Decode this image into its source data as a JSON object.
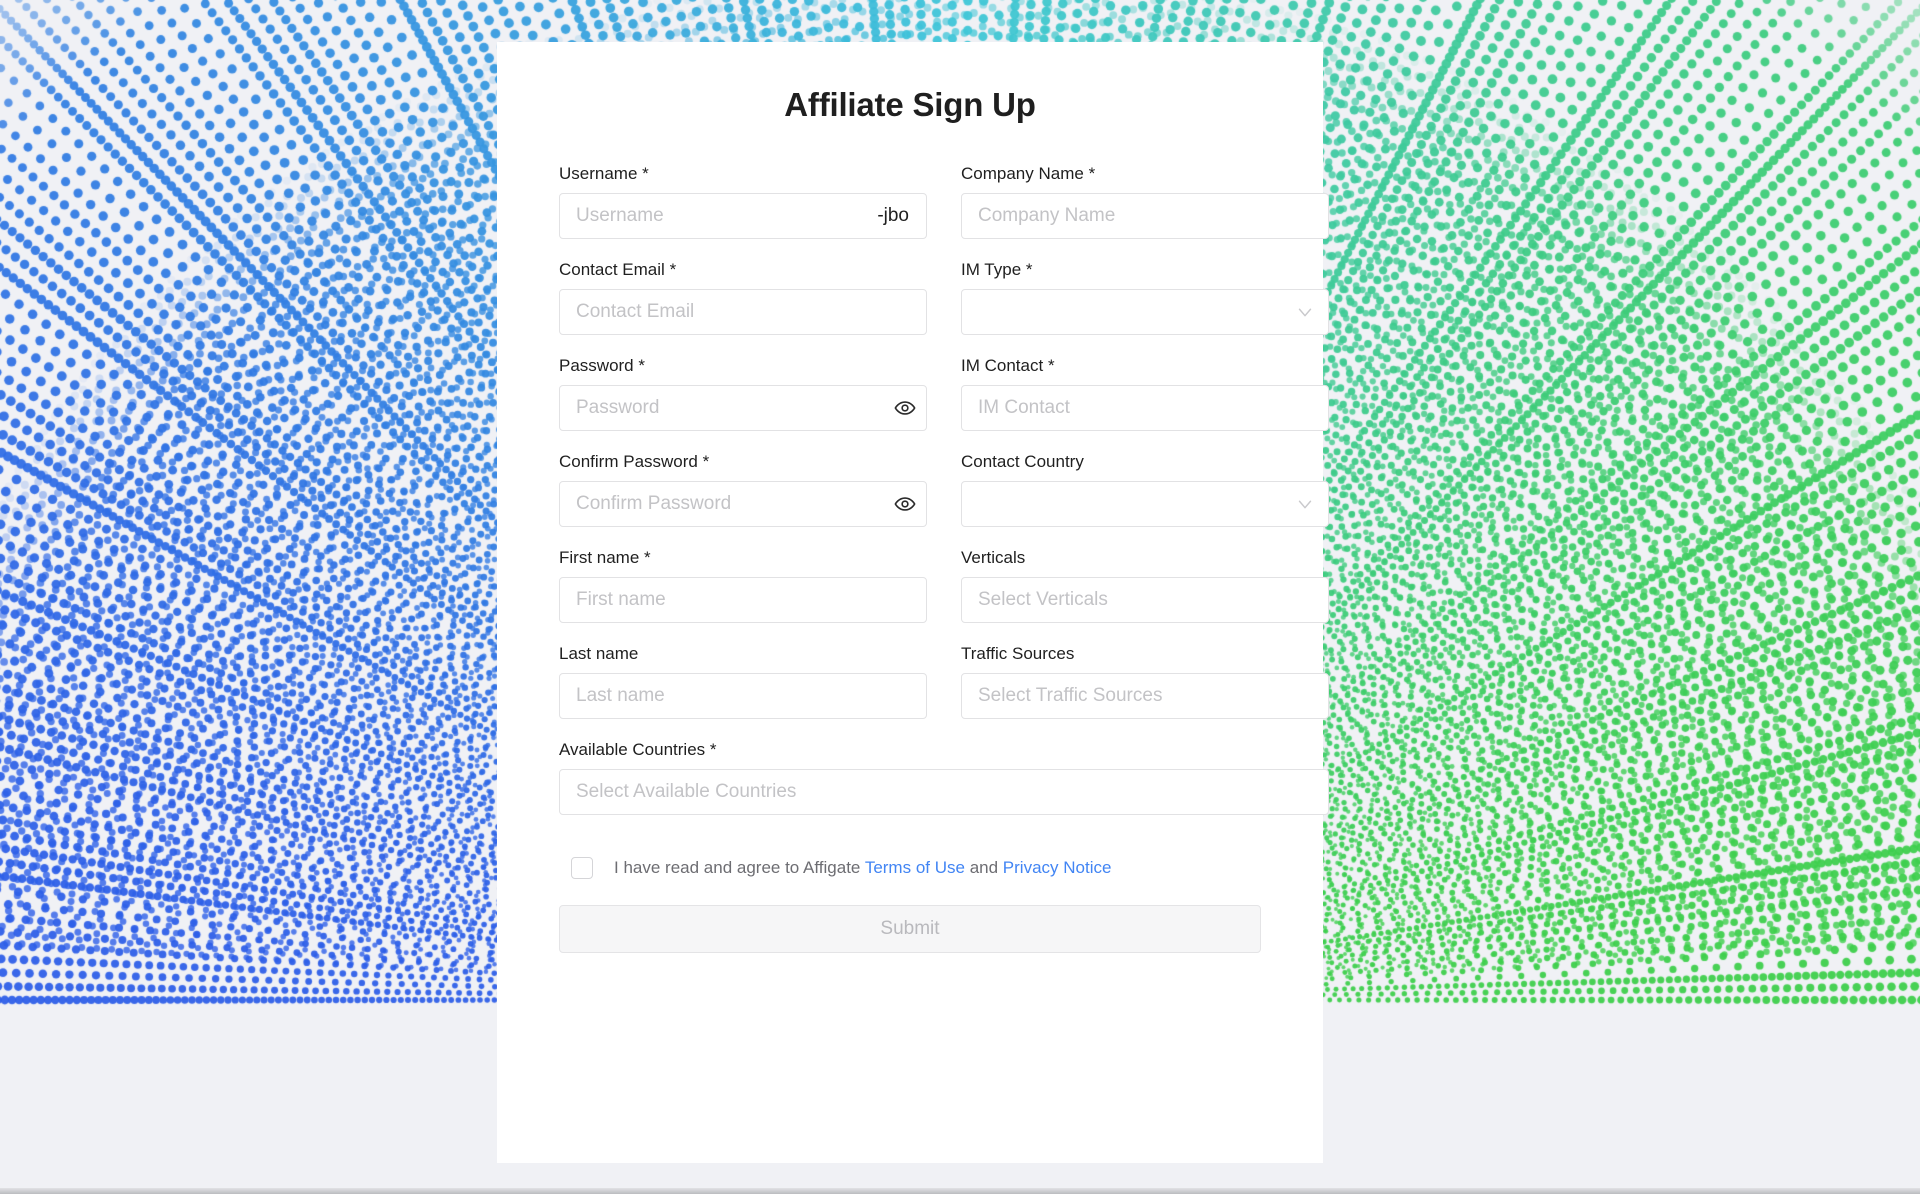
{
  "page": {
    "title": "Affiliate Sign Up",
    "background_color": "#f0f1f5",
    "card_background": "#ffffff",
    "link_color": "#4285f4",
    "decor": {
      "left_color": "#2e5fe8",
      "mid_color": "#3fc6d8",
      "right_color": "#3ecf4c"
    }
  },
  "form": {
    "fields": {
      "username": {
        "label": "Username",
        "required_mark": "*",
        "placeholder": "Username",
        "value": "",
        "suffix": "-jbo"
      },
      "company_name": {
        "label": "Company Name",
        "required_mark": "*",
        "placeholder": "Company Name",
        "value": ""
      },
      "contact_email": {
        "label": "Contact Email",
        "required_mark": "*",
        "placeholder": "Contact Email",
        "value": ""
      },
      "im_type": {
        "label": "IM Type",
        "required_mark": "*",
        "placeholder": "",
        "value": ""
      },
      "password": {
        "label": "Password",
        "required_mark": "*",
        "placeholder": "Password",
        "value": ""
      },
      "im_contact": {
        "label": "IM Contact",
        "required_mark": "*",
        "placeholder": "IM Contact",
        "value": ""
      },
      "confirm_password": {
        "label": "Confirm Password",
        "required_mark": "*",
        "placeholder": "Confirm Password",
        "value": ""
      },
      "contact_country": {
        "label": "Contact Country",
        "required_mark": "",
        "placeholder": "",
        "value": ""
      },
      "first_name": {
        "label": "First name",
        "required_mark": "*",
        "placeholder": "First name",
        "value": ""
      },
      "verticals": {
        "label": "Verticals",
        "required_mark": "",
        "placeholder": "Select Verticals",
        "value": ""
      },
      "last_name": {
        "label": "Last name",
        "required_mark": "",
        "placeholder": "Last name",
        "value": ""
      },
      "traffic_sources": {
        "label": "Traffic Sources",
        "required_mark": "",
        "placeholder": "Select Traffic Sources",
        "value": ""
      },
      "available_countries": {
        "label": "Available Countries",
        "required_mark": "*",
        "placeholder": "Select Available Countries",
        "value": ""
      }
    },
    "terms": {
      "prefix": "I have read and agree to Affigate",
      "terms_link": "Terms of Use",
      "conjunction": "and",
      "privacy_link": "Privacy Notice",
      "checked": false
    },
    "submit": {
      "label": "Submit",
      "disabled": true
    }
  },
  "icons": {
    "eye": "eye-icon",
    "chevron_down": "chevron-down-icon"
  }
}
